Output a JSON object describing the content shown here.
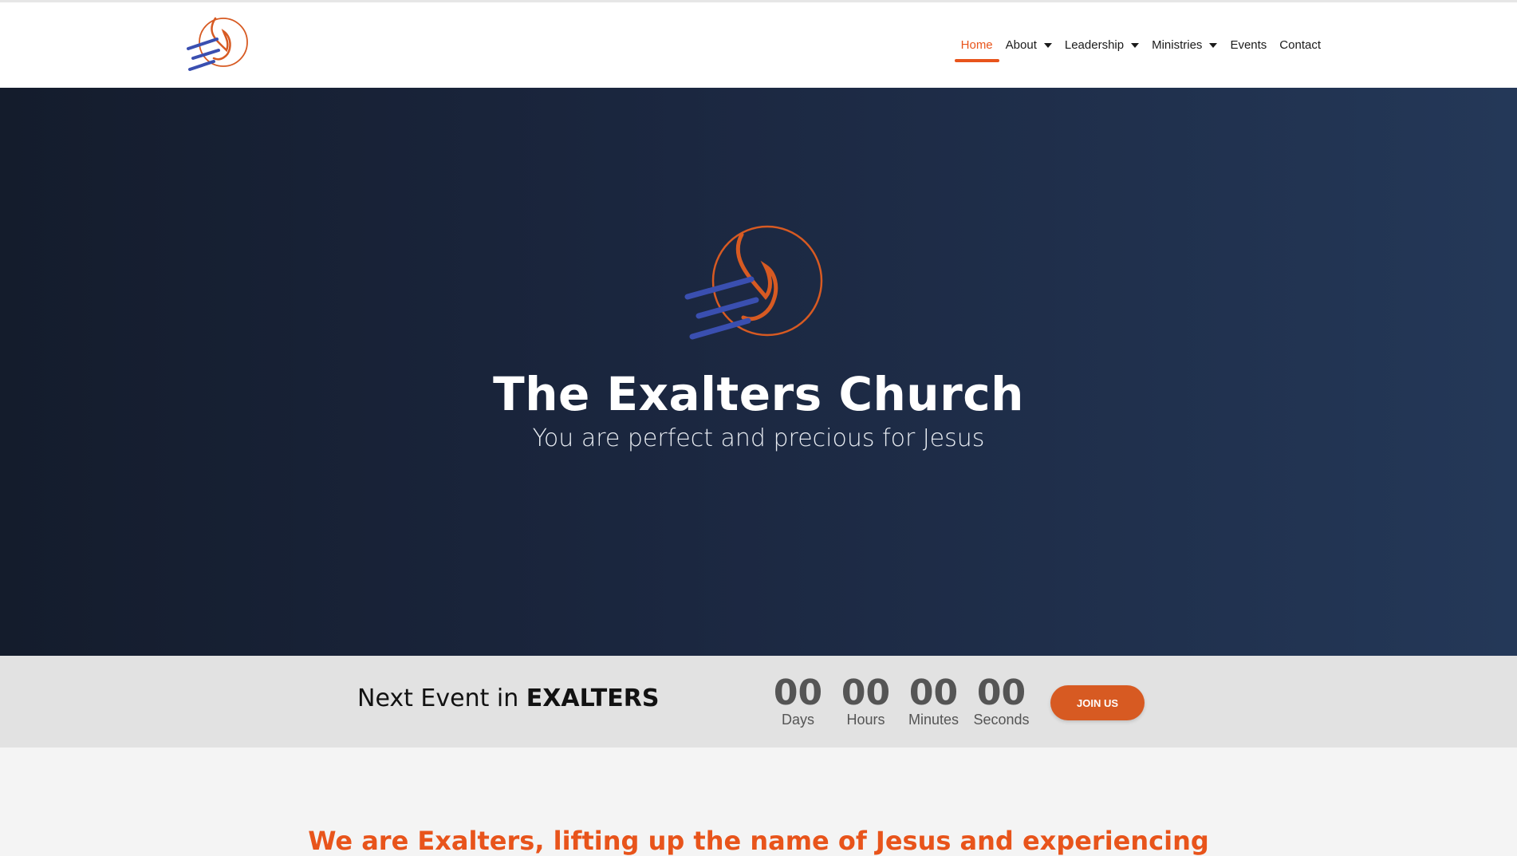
{
  "brand": {
    "accent": "#e8541b",
    "navy": "#1b2740"
  },
  "nav": {
    "items": [
      {
        "label": "Home",
        "active": true,
        "dropdown": false
      },
      {
        "label": "About",
        "active": false,
        "dropdown": true
      },
      {
        "label": "Leadership",
        "active": false,
        "dropdown": true
      },
      {
        "label": "Ministries",
        "active": false,
        "dropdown": true
      },
      {
        "label": "Events",
        "active": false,
        "dropdown": false
      },
      {
        "label": "Contact",
        "active": false,
        "dropdown": false
      }
    ]
  },
  "hero": {
    "title": "The Exalters Church",
    "subtitle": "You are perfect and precious for Jesus"
  },
  "countdown": {
    "prefix": "Next Event in ",
    "highlight": "EXALTERS",
    "units": [
      {
        "value": "00",
        "label": "Days"
      },
      {
        "value": "00",
        "label": "Hours"
      },
      {
        "value": "00",
        "label": "Minutes"
      },
      {
        "value": "00",
        "label": "Seconds"
      }
    ],
    "button": "JOIN US"
  },
  "intro": {
    "heading": "We are Exalters, lifting up the name of Jesus and experiencing"
  }
}
